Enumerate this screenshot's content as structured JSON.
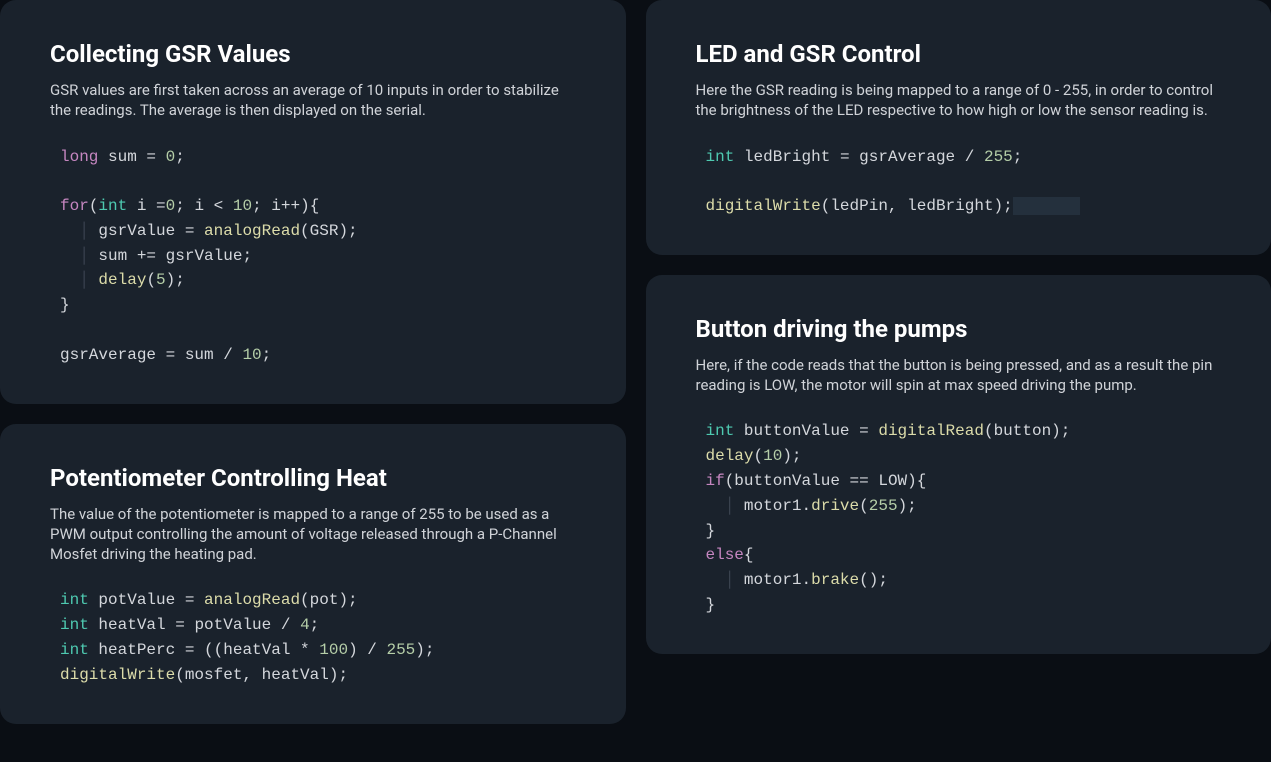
{
  "cards": {
    "gsr": {
      "title": "Collecting GSR Values",
      "desc": "GSR values are first taken across an average of 10 inputs in order to stabilize the readings. The average is then displayed on the serial.",
      "code": [
        [
          {
            "t": "long",
            "c": "kw"
          },
          {
            "t": " sum ",
            "c": "id"
          },
          {
            "t": "= ",
            "c": "op"
          },
          {
            "t": "0",
            "c": "num"
          },
          {
            "t": ";",
            "c": "op"
          }
        ],
        [],
        [
          {
            "t": "for",
            "c": "kw"
          },
          {
            "t": "(",
            "c": "op"
          },
          {
            "t": "int",
            "c": "ty"
          },
          {
            "t": " i ",
            "c": "id"
          },
          {
            "t": "=",
            "c": "op"
          },
          {
            "t": "0",
            "c": "num"
          },
          {
            "t": "; i ",
            "c": "id"
          },
          {
            "t": "< ",
            "c": "op"
          },
          {
            "t": "10",
            "c": "num"
          },
          {
            "t": "; i",
            "c": "id"
          },
          {
            "t": "++",
            "c": "op"
          },
          {
            "t": "){",
            "c": "op"
          }
        ],
        [
          {
            "t": "  ",
            "c": "op"
          },
          {
            "t": "│",
            "c": "bar"
          },
          {
            "t": " gsrValue ",
            "c": "id"
          },
          {
            "t": "= ",
            "c": "op"
          },
          {
            "t": "analogRead",
            "c": "fn"
          },
          {
            "t": "(GSR);",
            "c": "op"
          }
        ],
        [
          {
            "t": "  ",
            "c": "op"
          },
          {
            "t": "│",
            "c": "bar"
          },
          {
            "t": " sum ",
            "c": "id"
          },
          {
            "t": "+= ",
            "c": "op"
          },
          {
            "t": "gsrValue;",
            "c": "id"
          }
        ],
        [
          {
            "t": "  ",
            "c": "op"
          },
          {
            "t": "│",
            "c": "bar"
          },
          {
            "t": " ",
            "c": "op"
          },
          {
            "t": "delay",
            "c": "fn"
          },
          {
            "t": "(",
            "c": "op"
          },
          {
            "t": "5",
            "c": "num"
          },
          {
            "t": ");",
            "c": "op"
          }
        ],
        [
          {
            "t": "}",
            "c": "op"
          }
        ],
        [],
        [
          {
            "t": "gsrAverage ",
            "c": "id"
          },
          {
            "t": "= ",
            "c": "op"
          },
          {
            "t": "sum ",
            "c": "id"
          },
          {
            "t": "/ ",
            "c": "op"
          },
          {
            "t": "10",
            "c": "num"
          },
          {
            "t": ";",
            "c": "op"
          }
        ]
      ]
    },
    "pot": {
      "title": "Potentiometer Controlling Heat",
      "desc": "The value of the potentiometer is mapped to a range of 255 to be used as a PWM output controlling the amount of voltage released through a P-Channel Mosfet driving the heating pad.",
      "code": [
        [
          {
            "t": "int",
            "c": "ty"
          },
          {
            "t": " potValue ",
            "c": "id"
          },
          {
            "t": "= ",
            "c": "op"
          },
          {
            "t": "analogRead",
            "c": "fn"
          },
          {
            "t": "(pot);",
            "c": "op"
          }
        ],
        [
          {
            "t": "int",
            "c": "ty"
          },
          {
            "t": " heatVal ",
            "c": "id"
          },
          {
            "t": "= ",
            "c": "op"
          },
          {
            "t": "potValue ",
            "c": "id"
          },
          {
            "t": "/ ",
            "c": "op"
          },
          {
            "t": "4",
            "c": "num"
          },
          {
            "t": ";",
            "c": "op"
          }
        ],
        [
          {
            "t": "int",
            "c": "ty"
          },
          {
            "t": " heatPerc ",
            "c": "id"
          },
          {
            "t": "= ",
            "c": "op"
          },
          {
            "t": "((heatVal ",
            "c": "id"
          },
          {
            "t": "* ",
            "c": "op"
          },
          {
            "t": "100",
            "c": "num"
          },
          {
            "t": ") ",
            "c": "op"
          },
          {
            "t": "/ ",
            "c": "op"
          },
          {
            "t": "255",
            "c": "num"
          },
          {
            "t": ");",
            "c": "op"
          }
        ],
        [
          {
            "t": "digitalWrite",
            "c": "fn"
          },
          {
            "t": "(mosfet, heatVal);",
            "c": "op"
          }
        ]
      ]
    },
    "led": {
      "title": "LED and GSR Control",
      "desc": "Here the GSR reading is being mapped to a range of 0 - 255, in order to control the brightness of the LED respective to how high or low the sensor reading is.",
      "code": [
        [
          {
            "t": "int",
            "c": "ty"
          },
          {
            "t": " ledBright ",
            "c": "id"
          },
          {
            "t": "= ",
            "c": "op"
          },
          {
            "t": "gsrAverage ",
            "c": "id"
          },
          {
            "t": "/ ",
            "c": "op"
          },
          {
            "t": "255",
            "c": "num"
          },
          {
            "t": ";",
            "c": "op"
          }
        ],
        [],
        [
          {
            "t": "digitalWrite",
            "c": "fn"
          },
          {
            "t": "(ledPin, ledBright);",
            "c": "op"
          },
          {
            "t": "       ",
            "c": "hl"
          }
        ]
      ]
    },
    "button": {
      "title": "Button driving the pumps",
      "desc": "Here, if the code reads that the button is being pressed, and as a result the pin reading is LOW, the motor will spin at max speed driving the pump.",
      "code": [
        [
          {
            "t": "int",
            "c": "ty"
          },
          {
            "t": " buttonValue ",
            "c": "id"
          },
          {
            "t": "= ",
            "c": "op"
          },
          {
            "t": "digitalRead",
            "c": "fn"
          },
          {
            "t": "(button);",
            "c": "op"
          }
        ],
        [
          {
            "t": "delay",
            "c": "fn"
          },
          {
            "t": "(",
            "c": "op"
          },
          {
            "t": "10",
            "c": "num"
          },
          {
            "t": ");",
            "c": "op"
          }
        ],
        [
          {
            "t": "if",
            "c": "kw"
          },
          {
            "t": "(buttonValue ",
            "c": "id"
          },
          {
            "t": "== ",
            "c": "op"
          },
          {
            "t": "LOW){",
            "c": "id"
          }
        ],
        [
          {
            "t": "  ",
            "c": "op"
          },
          {
            "t": "│",
            "c": "bar"
          },
          {
            "t": " motor1.",
            "c": "id"
          },
          {
            "t": "drive",
            "c": "fn"
          },
          {
            "t": "(",
            "c": "op"
          },
          {
            "t": "255",
            "c": "num"
          },
          {
            "t": ");",
            "c": "op"
          }
        ],
        [
          {
            "t": "}",
            "c": "op"
          }
        ],
        [
          {
            "t": "else",
            "c": "kw"
          },
          {
            "t": "{",
            "c": "op"
          }
        ],
        [
          {
            "t": "  ",
            "c": "op"
          },
          {
            "t": "│",
            "c": "bar"
          },
          {
            "t": " motor1.",
            "c": "id"
          },
          {
            "t": "brake",
            "c": "fn"
          },
          {
            "t": "();",
            "c": "op"
          }
        ],
        [
          {
            "t": "}",
            "c": "op"
          }
        ]
      ]
    }
  }
}
